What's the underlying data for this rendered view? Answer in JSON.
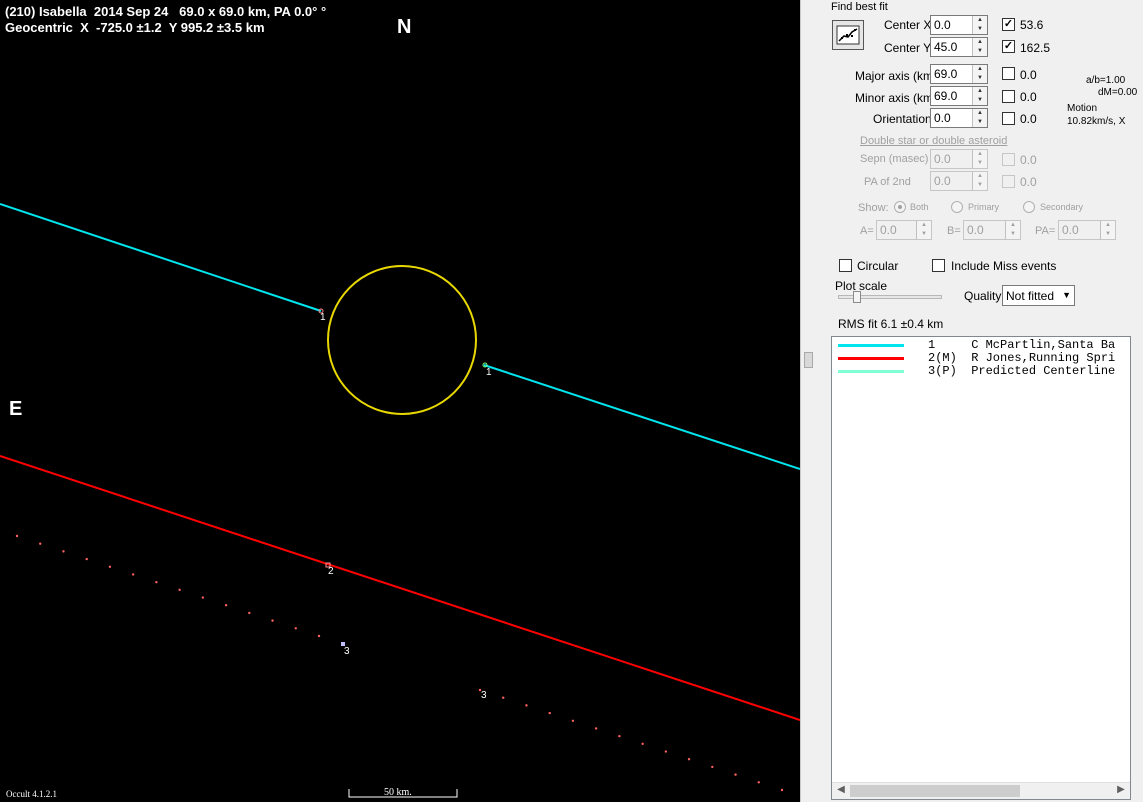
{
  "plot": {
    "header_line1": "(210) Isabella  2014 Sep 24   69.0 x 69.0 km, PA 0.0° °",
    "header_line2": "Geocentric  X  -725.0 ±1.2  Y 995.2 ±3.5 km",
    "north_label": "N",
    "east_label": "E",
    "version": "Occult 4.1.2.1",
    "scale_label": "50 km.",
    "chord_markers": [
      "1",
      "1",
      "2",
      "3",
      "3"
    ],
    "colors": {
      "background": "#000000",
      "chord1": "#00e5ee",
      "chord2": "#ff0000",
      "ellipse": "#e8d800",
      "predicted_dots": "#ff6060"
    }
  },
  "panel": {
    "find_best_fit": "Find best fit",
    "fit_button_icon": "scatter-fit-icon",
    "center_x_label": "Center X",
    "center_x_value": "0.0",
    "center_x_checked": true,
    "center_x_result": "53.6",
    "center_y_label": "Center Y",
    "center_y_value": "45.0",
    "center_y_checked": true,
    "center_y_result": "162.5",
    "major_label": "Major axis (km)",
    "major_value": "69.0",
    "major_checked": false,
    "major_result": "0.0",
    "minor_label": "Minor axis (km)",
    "minor_value": "69.0",
    "minor_checked": false,
    "minor_result": "0.0",
    "orient_label": "Orientation",
    "orient_value": "0.0",
    "orient_checked": false,
    "orient_result": "0.0",
    "ab_ratio": "a/b=1.00",
    "dm": "dM=0.00",
    "motion_label": "Motion",
    "motion_value": "10.82km/s, X",
    "double_star": "Double star  or  double asteroid",
    "sepn_label": "Sepn (masec)",
    "sepn_value": "0.0",
    "sepn_result": "0.0",
    "pa2_label": "PA of 2nd",
    "pa2_value": "0.0",
    "pa2_result": "0.0",
    "show_label": "Show:",
    "show_both": "Both",
    "show_primary": "Primary",
    "show_secondary": "Secondary",
    "a_label": "A=",
    "a_value": "0.0",
    "b_label": "B=",
    "b_value": "0.0",
    "pa_label": "PA=",
    "pa_value": "0.0",
    "circular_label": "Circular",
    "circular_checked": false,
    "include_miss_label": "Include Miss events",
    "include_miss_checked": false,
    "plot_scale_label": "Plot scale",
    "plot_scale_fraction": 0.18,
    "quality_label": "Quality",
    "quality_value": "Not fitted",
    "rms_fit": "RMS fit 6.1 ±0.4 km"
  },
  "legend": [
    {
      "text": "1     C McPartlin,Santa Ba",
      "color": "#00e5ee"
    },
    {
      "text": "2(M)  R Jones,Running Spri",
      "color": "#ff0000"
    },
    {
      "text": "3(P)  Predicted Centerline",
      "color": "#80ffd4"
    }
  ]
}
